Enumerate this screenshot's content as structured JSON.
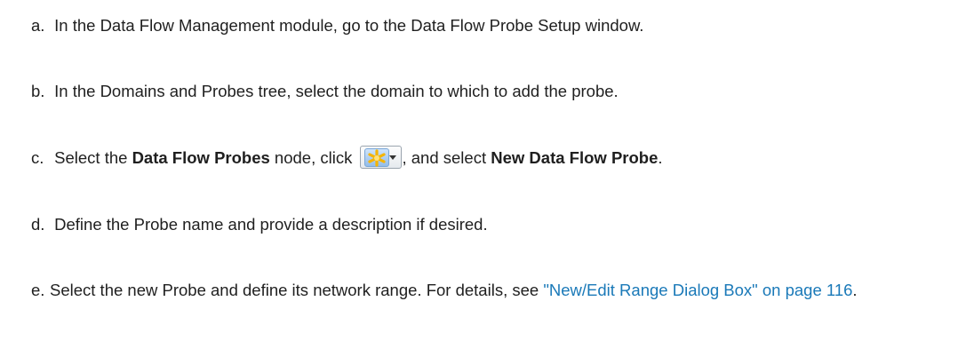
{
  "steps": [
    {
      "marker": "a.",
      "text": "In the Data Flow Management module, go to the Data Flow Probe Setup window."
    },
    {
      "marker": "b.",
      "text": "In the Domains and Probes tree, select the domain to which to add the probe."
    },
    {
      "marker": "c.",
      "pre": "Select the ",
      "bold1": "Data Flow Probes",
      "mid": " node, click ",
      "icon": "new-item-star-dropdown-icon",
      "post": ", and select ",
      "bold2": "New Data Flow Probe",
      "end": "."
    },
    {
      "marker": "d.",
      "text": "Define the Probe name and provide a description if desired."
    },
    {
      "marker": "e.",
      "pre": "Select the new Probe and define its network range. For details, see ",
      "link": "\"New/Edit Range Dialog Box\" on page 116",
      "end": "."
    }
  ],
  "colors": {
    "text": "#1f1f1f",
    "link": "#1a79b8",
    "icon_star": "#f5b400"
  }
}
